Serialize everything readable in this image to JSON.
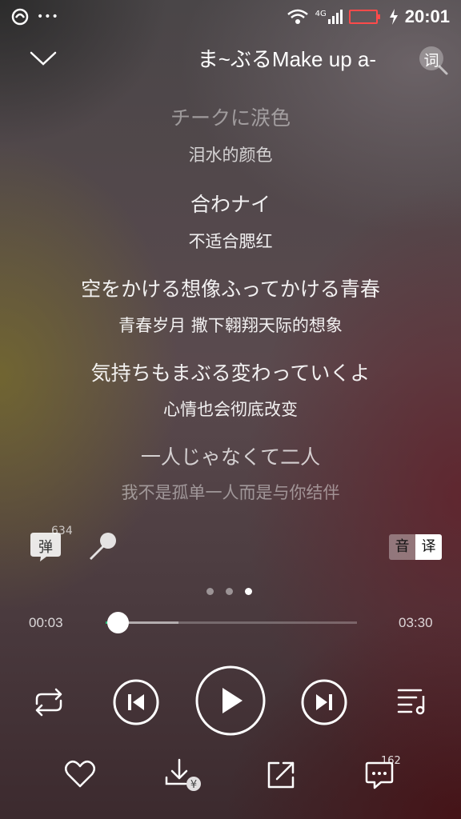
{
  "status_bar": {
    "time": "20:01",
    "network": "4G",
    "icons": [
      "app-icon",
      "more-icon",
      "wifi-icon",
      "signal-icon",
      "battery-icon",
      "charging-icon"
    ]
  },
  "header": {
    "title": "ま~ぶるMake up a-",
    "lyrics_button_label": "词"
  },
  "lyrics": [
    {
      "original": "チークに涙色",
      "translation": "泪水的颜色"
    },
    {
      "original": "合わナイ",
      "translation": "不适合腮红"
    },
    {
      "original": "空をかける想像ふってかける青春",
      "translation": "青春岁月 撒下翱翔天际的想象"
    },
    {
      "original": "気持ちもまぶる変わっていくよ",
      "translation": "心情也会彻底改变"
    },
    {
      "original": "一人じゃなくて二人",
      "translation": "我不是孤单一人而是与你结伴"
    }
  ],
  "tools": {
    "danmu_label": "弹",
    "danmu_count": "634",
    "original_label": "音",
    "translate_label": "译"
  },
  "pager": {
    "pages": 3,
    "active": 3
  },
  "progress": {
    "current": "00:03",
    "total": "03:30",
    "played_fraction": 0.014,
    "buffered_fraction": 0.29
  },
  "actions": {
    "comment_count": "162"
  }
}
